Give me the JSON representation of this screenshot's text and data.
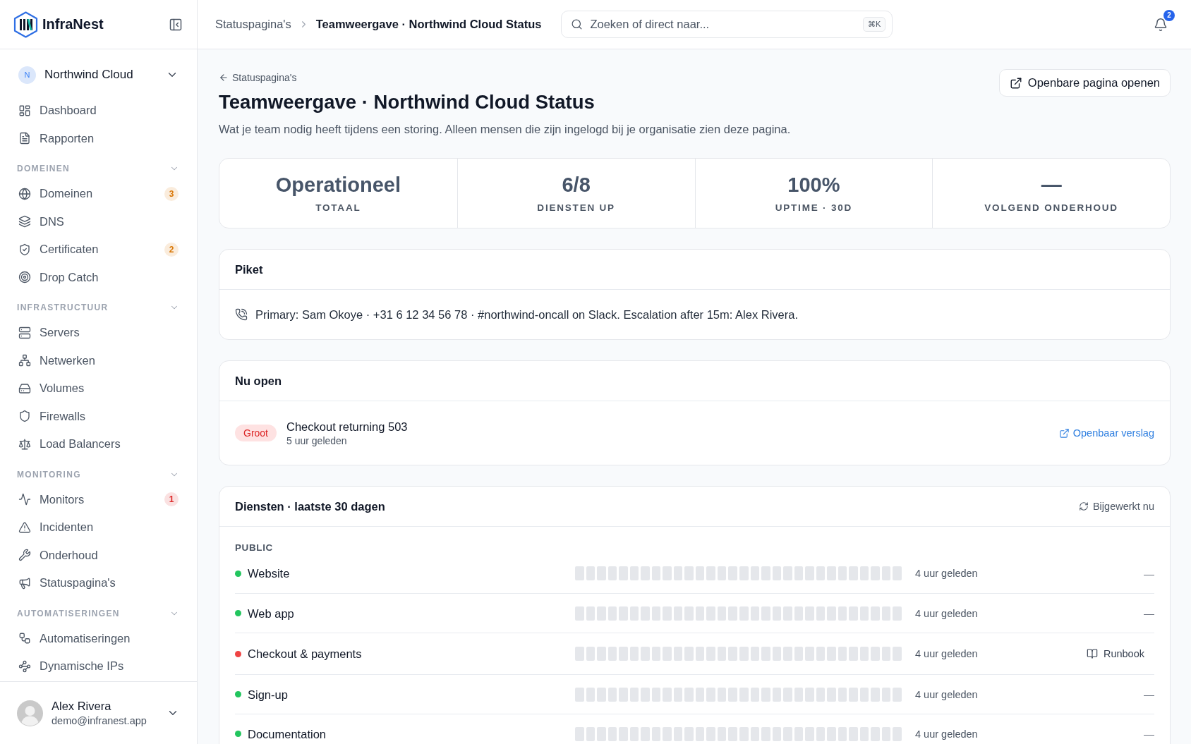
{
  "sidebar": {
    "brand": "InfraNest",
    "org": {
      "initial": "N",
      "name": "Northwind Cloud"
    },
    "sections": [
      {
        "items": [
          {
            "label": "Dashboard",
            "selected": false
          },
          {
            "label": "Rapporten",
            "selected": false
          }
        ]
      },
      {
        "title": "DOMEINEN",
        "expanded": true,
        "items": [
          {
            "label": "Domeinen",
            "selected": false,
            "badge": {
              "text": "3",
              "color": "#d97706"
            }
          },
          {
            "label": "DNS",
            "selected": false
          },
          {
            "label": "Certificaten",
            "selected": false,
            "badge": {
              "text": "2",
              "color": "#d97706"
            }
          },
          {
            "label": "Drop Catch",
            "selected": false
          }
        ]
      },
      {
        "title": "INFRASTRUCTUUR",
        "expanded": true,
        "items": [
          {
            "label": "Servers",
            "selected": false
          },
          {
            "label": "Netwerken",
            "selected": false
          },
          {
            "label": "Volumes",
            "selected": false
          },
          {
            "label": "Firewalls",
            "selected": false
          },
          {
            "label": "Load Balancers",
            "selected": false
          }
        ]
      },
      {
        "title": "MONITORING",
        "expanded": true,
        "items": [
          {
            "label": "Monitors",
            "selected": false,
            "badge": {
              "text": "1",
              "color": "#dc2626"
            }
          },
          {
            "label": "Incidenten",
            "selected": false
          },
          {
            "label": "Onderhoud",
            "selected": false
          },
          {
            "label": "Statuspagina's",
            "selected": false
          }
        ]
      },
      {
        "title": "AUTOMATISERINGEN",
        "expanded": true,
        "items": [
          {
            "label": "Automatiseringen",
            "selected": false
          },
          {
            "label": "Dynamische IPs",
            "selected": false
          }
        ]
      }
    ],
    "user": {
      "name": "Alex Rivera",
      "email": "demo@infranest.app"
    }
  },
  "header": {
    "breadcrumb": [
      {
        "label": "Statuspagina's",
        "current": false
      },
      {
        "label": "Teamweergave · Northwind Cloud Status",
        "current": true
      }
    ],
    "search": {
      "placeholder": "Zoeken of direct naar...",
      "shortcut": "⌘K"
    },
    "notifications": {
      "count": "2"
    }
  },
  "page": {
    "back": "Statuspagina's",
    "title": "Teamweergave · Northwind Cloud Status",
    "description": "Wat je team nodig heeft tijdens een storing. Alleen mensen die zijn ingelogd bij je organisatie zien deze pagina.",
    "action": "Openbare pagina openen"
  },
  "stats": [
    {
      "value": "Operationeel",
      "label": "TOTAAL"
    },
    {
      "value": "6/8",
      "label": "DIENSTEN UP"
    },
    {
      "value": "100%",
      "label": "UPTIME · 30D"
    },
    {
      "value": "—",
      "label": "VOLGEND ONDERHOUD"
    }
  ],
  "oncall": {
    "title": "Piket",
    "text": "Primary: Sam Okoye · +31 6 12 34 56 78 · #northwind-oncall on Slack. Escalation after 15m: Alex Rivera."
  },
  "open_incidents": {
    "title": "Nu open",
    "items": [
      {
        "severity": "Groot",
        "title": "Checkout returning 503",
        "time": "5 uur geleden",
        "link": "Openbaar verslag"
      }
    ]
  },
  "services": {
    "title": "Diensten · laatste 30 dagen",
    "updated": "Bijgewerkt nu",
    "groups": [
      {
        "name": "PUBLIC",
        "items": [
          {
            "name": "Website",
            "color": "#22c55e",
            "time": "4 uur geleden",
            "action": {
              "kind": "dash",
              "text": "—"
            }
          },
          {
            "name": "Web app",
            "color": "#22c55e",
            "time": "4 uur geleden",
            "action": {
              "kind": "dash",
              "text": "—"
            }
          },
          {
            "name": "Checkout & payments",
            "color": "#ef4444",
            "time": "4 uur geleden",
            "action": {
              "kind": "button",
              "text": "Runbook"
            }
          },
          {
            "name": "Sign-up",
            "color": "#22c55e",
            "time": "4 uur geleden",
            "action": {
              "kind": "dash",
              "text": "—"
            }
          },
          {
            "name": "Documentation",
            "color": "#22c55e",
            "time": "4 uur geleden",
            "action": {
              "kind": "dash",
              "text": "—"
            }
          }
        ]
      }
    ]
  }
}
